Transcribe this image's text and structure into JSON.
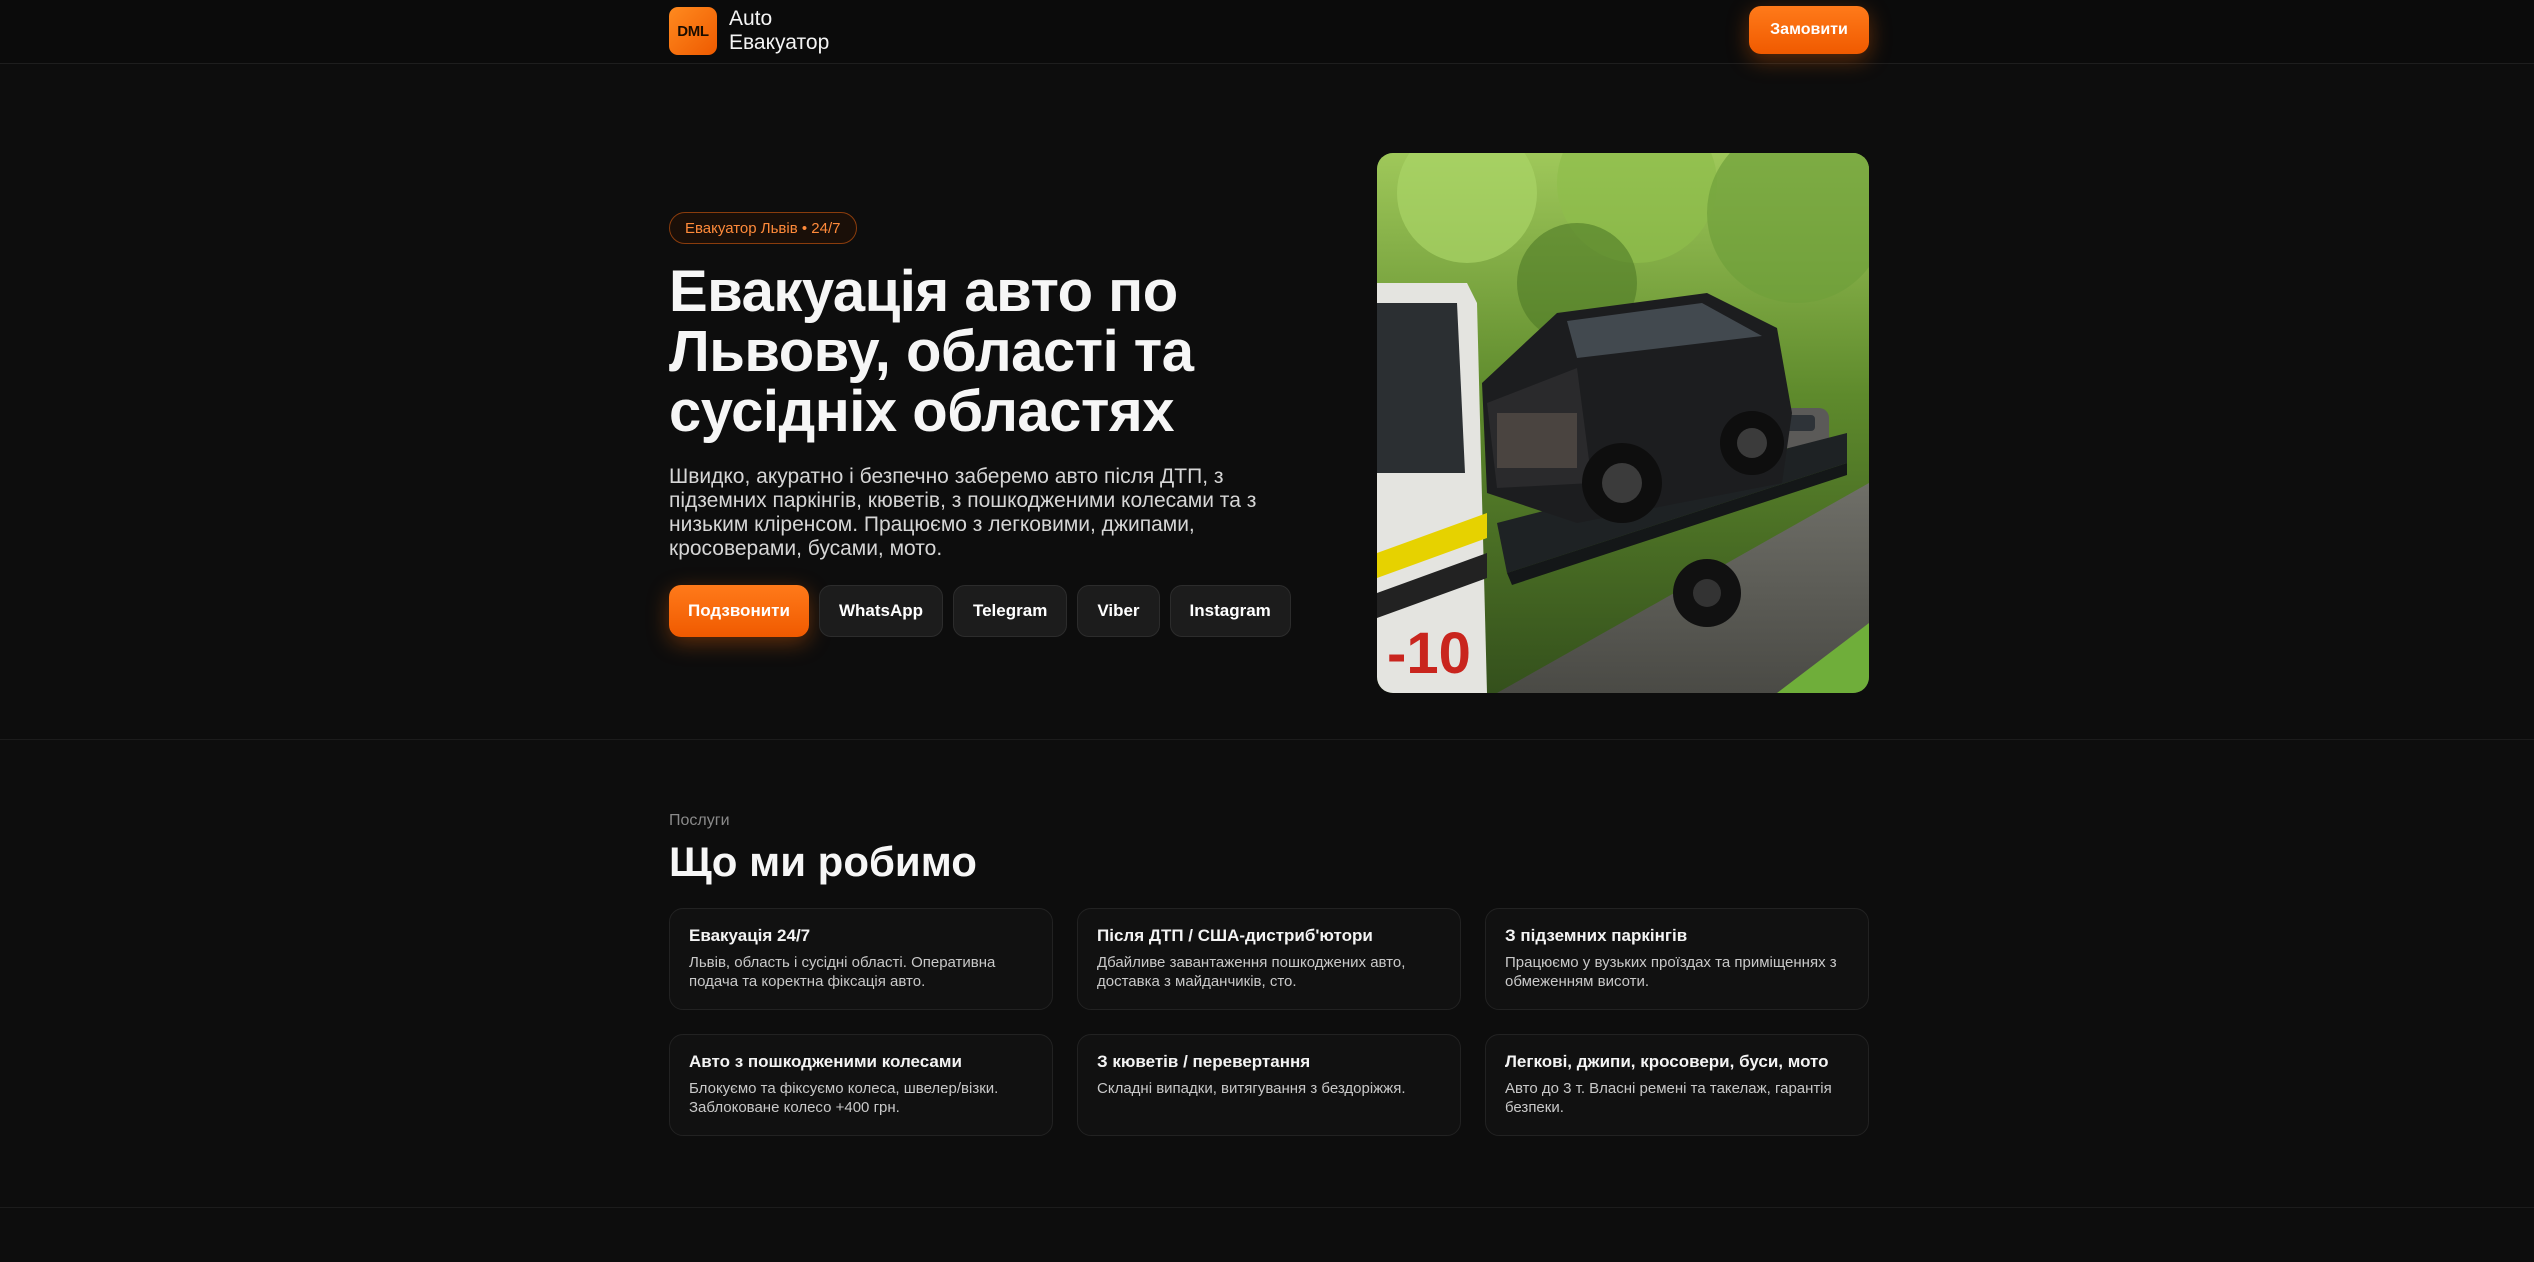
{
  "header": {
    "logo_badge": "DML",
    "logo_line1": "Auto",
    "logo_line2": "Евакуатор",
    "order_label": "Замовити"
  },
  "hero": {
    "pill": "Евакуатор Львів • 24/7",
    "title": "Евакуація авто по Львову, області та сусідніх областях",
    "description": "Швидко, акуратно і безпечно заберемо авто після ДТП, з підземних паркінгів, кюветів, з пошкодженими колесами та з низьким кліренсом. Працюємо з легковими, джипами, кросоверами, бусами, мото.",
    "buttons": [
      "Подзвонити",
      "WhatsApp",
      "Telegram",
      "Viber",
      "Instagram"
    ],
    "photo_icon": "tow-truck-photo"
  },
  "services": {
    "label": "Послуги",
    "title": "Що ми робимо",
    "cards": [
      {
        "title": "Евакуація 24/7",
        "text": "Львів, область і сусідні області. Оперативна подача та коректна фіксація авто."
      },
      {
        "title": "Після ДТП / США-дистриб'ютори",
        "text": "Дбайливе завантаження пошкоджених авто, доставка з майданчиків, сто."
      },
      {
        "title": "З підземних паркінгів",
        "text": "Працюємо у вузьких проїздах та приміщеннях з обмеженням висоти."
      },
      {
        "title": "Авто з пошкодженими колесами",
        "text": "Блокуємо та фіксуємо колеса, швелер/візки. Заблоковане колесо +400 грн."
      },
      {
        "title": "З кюветів / перевертання",
        "text": "Складні випадки, витягування з бездоріжжя."
      },
      {
        "title": "Легкові, джипи, кросовери, буси, мото",
        "text": "Авто до 3 т. Власні ремені та такелаж, гарантія безпеки."
      }
    ]
  },
  "colors": {
    "accent": "#f56400",
    "background": "#0d0d0d",
    "card": "#111111"
  }
}
